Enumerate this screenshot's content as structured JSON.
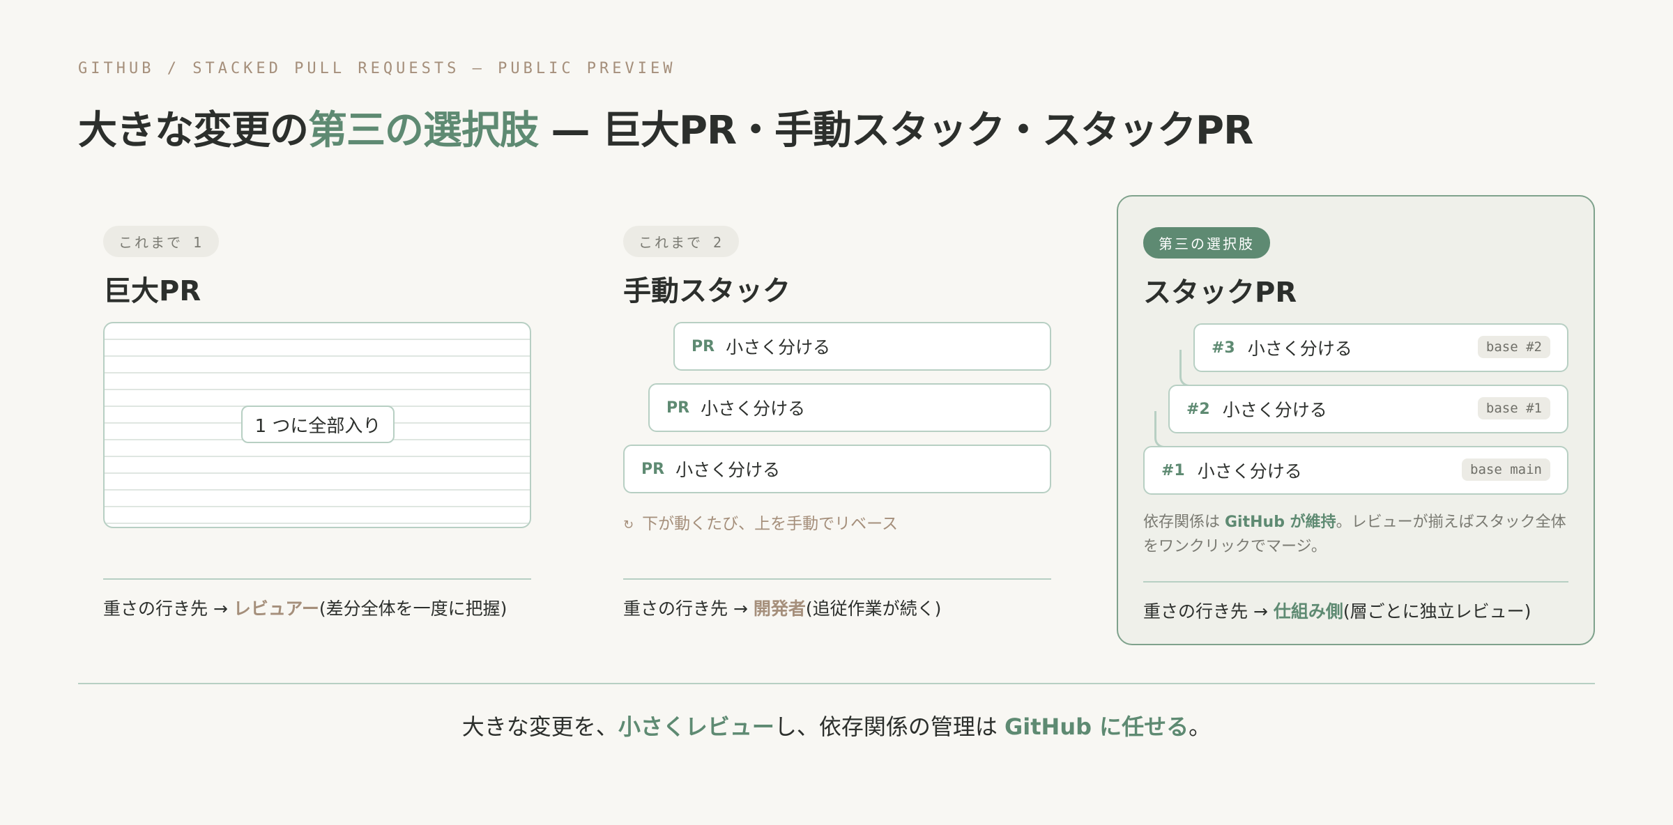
{
  "header": {
    "kicker": "GITHUB / STACKED PULL REQUESTS — PUBLIC PREVIEW",
    "title_pre": "大きな変更の",
    "title_accent": "第三の選択肢",
    "title_post": " — 巨大PR・手動スタック・スタックPR"
  },
  "columns": [
    {
      "pill": "これまで 1",
      "title": "巨大PR",
      "box_label": "1 つに全部入り",
      "weight_pre": "重さの行き先 → ",
      "weight_target": "レビュアー",
      "weight_post": "(差分全体を一度に把握)"
    },
    {
      "pill": "これまで 2",
      "title": "手動スタック",
      "cards": [
        {
          "tag": "PR",
          "label": "小さく分ける"
        },
        {
          "tag": "PR",
          "label": "小さく分ける"
        },
        {
          "tag": "PR",
          "label": "小さく分ける"
        }
      ],
      "note_icon": "↻",
      "note": "下が動くたび、上を手動でリベース",
      "weight_pre": "重さの行き先 → ",
      "weight_target": "開発者",
      "weight_post": "(追従作業が続く)"
    },
    {
      "pill": "第三の選択肢",
      "title": "スタックPR",
      "cards": [
        {
          "num": "#3",
          "label": "小さく分ける",
          "base": "base #2"
        },
        {
          "num": "#2",
          "label": "小さく分ける",
          "base": "base #1"
        },
        {
          "num": "#1",
          "label": "小さく分ける",
          "base": "base main"
        }
      ],
      "desc_pre": "依存関係は ",
      "desc_accent": "GitHub が維持",
      "desc_post": "。レビューが揃えばスタック全体をワンクリックでマージ。",
      "weight_pre": "重さの行き先 → ",
      "weight_target": "仕組み側",
      "weight_post": "(層ごとに独立レビュー)"
    }
  ],
  "footer": {
    "pre": "大きな変更を、",
    "accent1": "小さくレビュー",
    "mid": "し、依存関係の管理は ",
    "accent2": "GitHub に任せる",
    "post": "。"
  },
  "colors": {
    "accent_green": "#5e8a72",
    "accent_tan": "#a58f7b",
    "background": "#f8f7f3"
  }
}
